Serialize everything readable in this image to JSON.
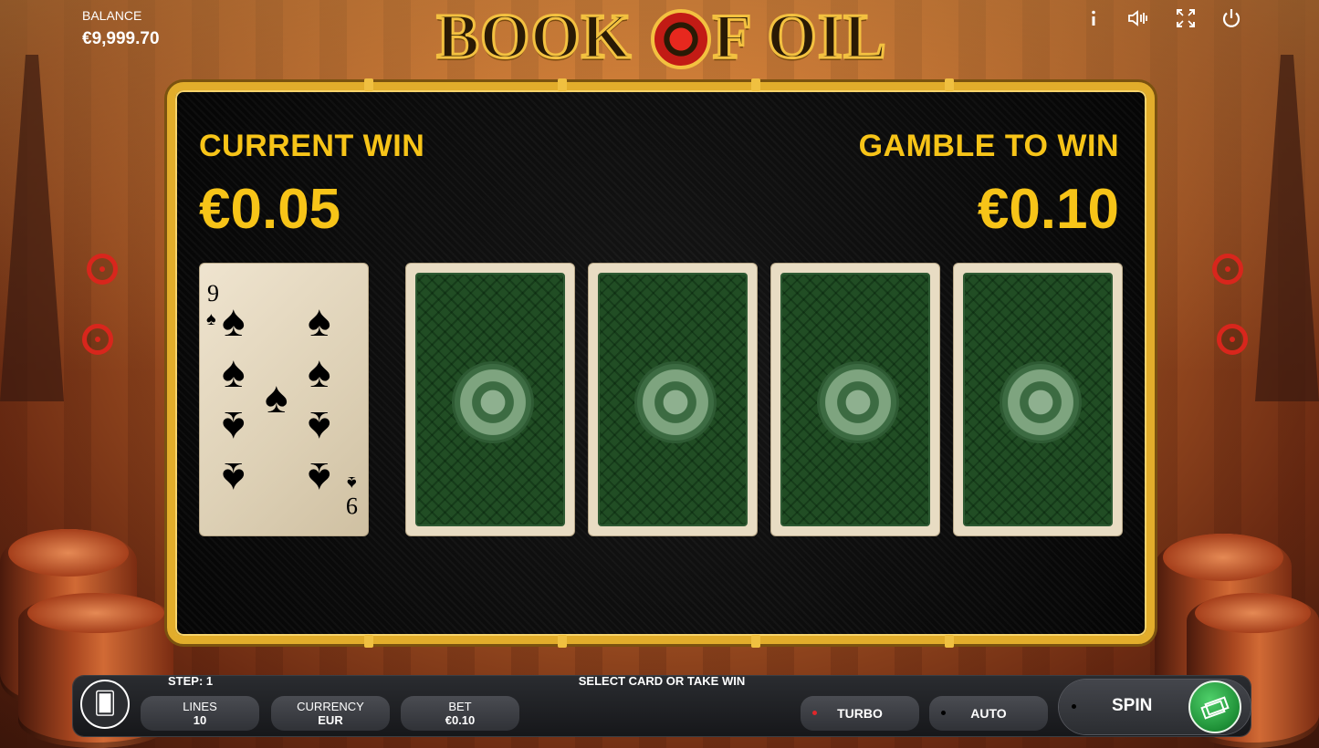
{
  "balance": {
    "label": "BALANCE",
    "value": "€9,999.70"
  },
  "logo": {
    "text_before": "BOOK ",
    "text_after": "F OIL"
  },
  "top_icons": [
    "info-icon",
    "sound-icon",
    "fullscreen-icon",
    "power-icon"
  ],
  "gamble": {
    "current_win_label": "CURRENT WIN",
    "current_win_value": "€0.05",
    "gamble_to_win_label": "GAMBLE TO WIN",
    "gamble_to_win_value": "€0.10",
    "revealed_card": {
      "rank": "9",
      "suit": "spades"
    },
    "hidden_cards": 4
  },
  "bottom": {
    "step": "STEP: 1",
    "message": "SELECT CARD OR TAKE WIN",
    "lines": {
      "label": "LINES",
      "value": "10"
    },
    "currency": {
      "label": "CURRENCY",
      "value": "EUR"
    },
    "bet": {
      "label": "BET",
      "value": "€0.10"
    },
    "turbo": "TURBO",
    "auto": "AUTO",
    "spin": "SPIN"
  },
  "colors": {
    "gold": "#f7c418",
    "frame": "#e2ad2b",
    "turbo_dot": "#e0262a",
    "spin_green": "#2db34a"
  }
}
